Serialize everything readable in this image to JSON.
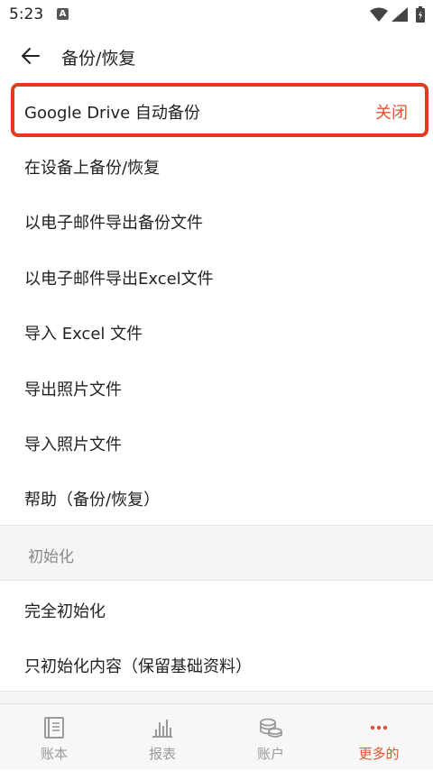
{
  "status_bar": {
    "time": "5:23",
    "notif_icon_letter": "A"
  },
  "app_bar": {
    "title": "备份/恢复"
  },
  "items": [
    {
      "label": "Google Drive 自动备份",
      "value": "关闭"
    },
    {
      "label": "在设备上备份/恢复"
    },
    {
      "label": "以电子邮件导出备份文件"
    },
    {
      "label": "以电子邮件导出Excel文件"
    },
    {
      "label": "导入 Excel 文件"
    },
    {
      "label": "导出照片文件"
    },
    {
      "label": "导入照片文件"
    },
    {
      "label": "帮助（备份/恢复）"
    }
  ],
  "section_header": "初始化",
  "init_items": [
    {
      "label": "完全初始化"
    },
    {
      "label": "只初始化内容（保留基础资料）"
    }
  ],
  "bottom_nav": [
    {
      "label": "账本",
      "icon": "book-icon"
    },
    {
      "label": "报表",
      "icon": "chart-icon"
    },
    {
      "label": "账户",
      "icon": "coins-icon"
    },
    {
      "label": "更多的",
      "icon": "more-icon",
      "active": true
    }
  ],
  "colors": {
    "accent": "#e0532f",
    "highlight_border": "#e53a1e",
    "section_bg": "#f5f5f5"
  }
}
